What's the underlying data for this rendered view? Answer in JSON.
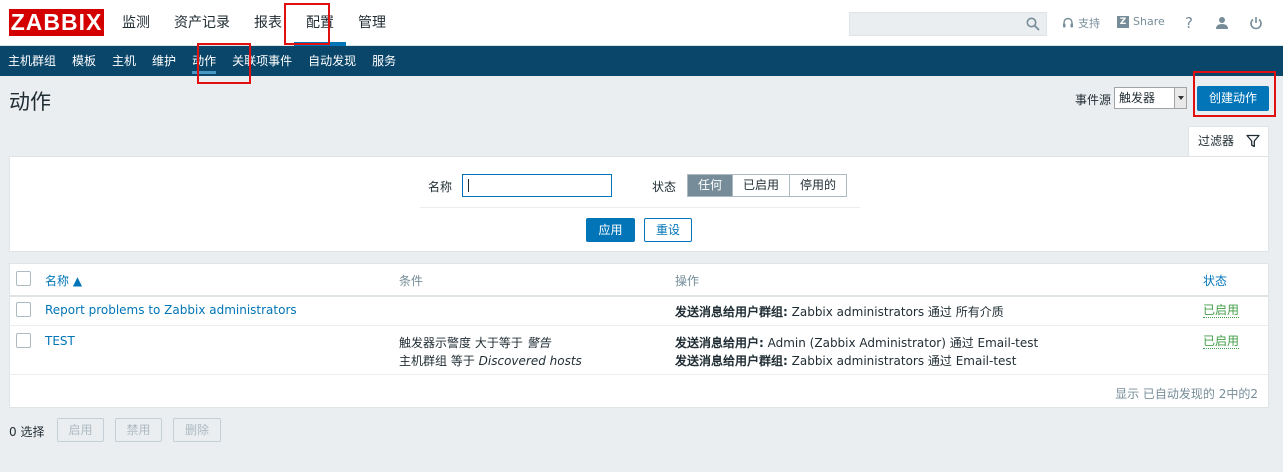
{
  "brand": {
    "logo_text": "ZABBIX",
    "logo_color": "#d40000"
  },
  "main_menu": [
    {
      "label": "监测",
      "active": false
    },
    {
      "label": "资产记录",
      "active": false
    },
    {
      "label": "报表",
      "active": false
    },
    {
      "label": "配置",
      "active": true
    },
    {
      "label": "管理",
      "active": false
    }
  ],
  "header": {
    "search_placeholder": "",
    "support_label": "支持",
    "share_label": "Share",
    "help_icon": "question-icon",
    "profile_icon": "user-icon",
    "logout_icon": "power-icon"
  },
  "sub_menu": [
    {
      "label": "主机群组",
      "active": false
    },
    {
      "label": "模板",
      "active": false
    },
    {
      "label": "主机",
      "active": false
    },
    {
      "label": "维护",
      "active": false
    },
    {
      "label": "动作",
      "active": true
    },
    {
      "label": "关联项事件",
      "active": false
    },
    {
      "label": "自动发现",
      "active": false
    },
    {
      "label": "服务",
      "active": false
    }
  ],
  "page": {
    "title": "动作",
    "event_source_label": "事件源",
    "event_source_value": "触发器",
    "create_button": "创建动作"
  },
  "filter": {
    "tab_label": "过滤器",
    "name_label": "名称",
    "name_value": "",
    "status_label": "状态",
    "status_options": [
      "任何",
      "已启用",
      "停用的"
    ],
    "status_selected": "任何",
    "apply_button": "应用",
    "reset_button": "重设"
  },
  "table": {
    "columns": {
      "name": "名称 ▲",
      "conditions": "条件",
      "operations": "操作",
      "status": "状态"
    },
    "rows": [
      {
        "name": "Report problems to Zabbix administrators",
        "conditions": [],
        "operations": [
          {
            "prefix": "发送消息给用户群组:",
            "text": " Zabbix administrators 通过 所有介质"
          }
        ],
        "status": "已启用"
      },
      {
        "name": "TEST",
        "conditions": [
          {
            "text": "触发器示警度 大于等于 ",
            "value": "警告"
          },
          {
            "text": "主机群组 等于 ",
            "value": "Discovered hosts"
          }
        ],
        "operations": [
          {
            "prefix": "发送消息给用户:",
            "text": " Admin (Zabbix Administrator) 通过 Email-test"
          },
          {
            "prefix": "发送消息给用户群组:",
            "text": " Zabbix administrators 通过 Email-test"
          }
        ],
        "status": "已启用"
      }
    ],
    "footer": "显示 已自动发现的 2中的2"
  },
  "mass_actions": {
    "selected_count": "0 选择",
    "enable": "启用",
    "disable": "禁用",
    "delete": "删除"
  },
  "colors": {
    "accent": "#0275b8",
    "subnav": "#0a466a",
    "enabled": "#429e47",
    "highlight": "#e01010"
  }
}
